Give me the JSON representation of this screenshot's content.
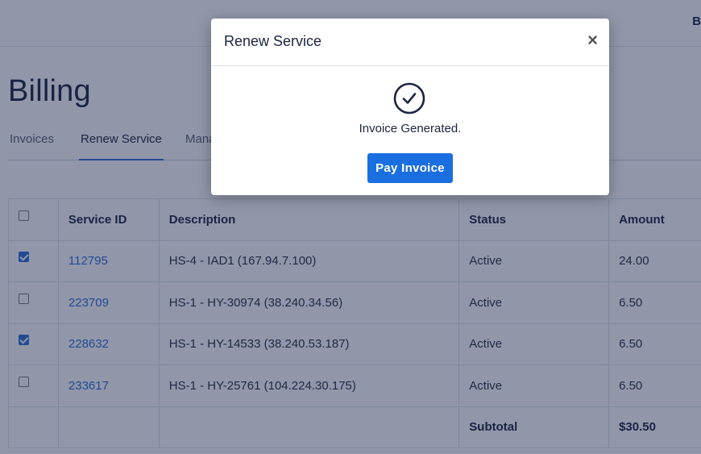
{
  "header": {
    "user_initial": "B"
  },
  "page": {
    "title": "Billing"
  },
  "tabs": [
    {
      "label": "Invoices",
      "active": false
    },
    {
      "label": "Renew Service",
      "active": true
    },
    {
      "label": "Mana",
      "active": false
    }
  ],
  "table": {
    "headers": {
      "service_id": "Service ID",
      "description": "Description",
      "status": "Status",
      "amount": "Amount"
    },
    "rows": [
      {
        "checked": true,
        "service_id": "112795",
        "description": "HS-4 - IAD1 (167.94.7.100)",
        "status": "Active",
        "amount": "24.00"
      },
      {
        "checked": false,
        "service_id": "223709",
        "description": "HS-1 - HY-30974 (38.240.34.56)",
        "status": "Active",
        "amount": "6.50"
      },
      {
        "checked": true,
        "service_id": "228632",
        "description": "HS-1 - HY-14533 (38.240.53.187)",
        "status": "Active",
        "amount": "6.50"
      },
      {
        "checked": false,
        "service_id": "233617",
        "description": "HS-1 - HY-25761 (104.224.30.175)",
        "status": "Active",
        "amount": "6.50"
      }
    ],
    "subtotal_label": "Subtotal",
    "subtotal_value": "$30.50"
  },
  "modal": {
    "title": "Renew Service",
    "close_symbol": "×",
    "message": "Invoice Generated.",
    "button_label": "Pay Invoice",
    "icon": "check-circle-icon"
  },
  "colors": {
    "accent": "#1a6fe0",
    "link": "#2f6fd6",
    "overlay": "rgba(22,34,72,0.47)"
  }
}
